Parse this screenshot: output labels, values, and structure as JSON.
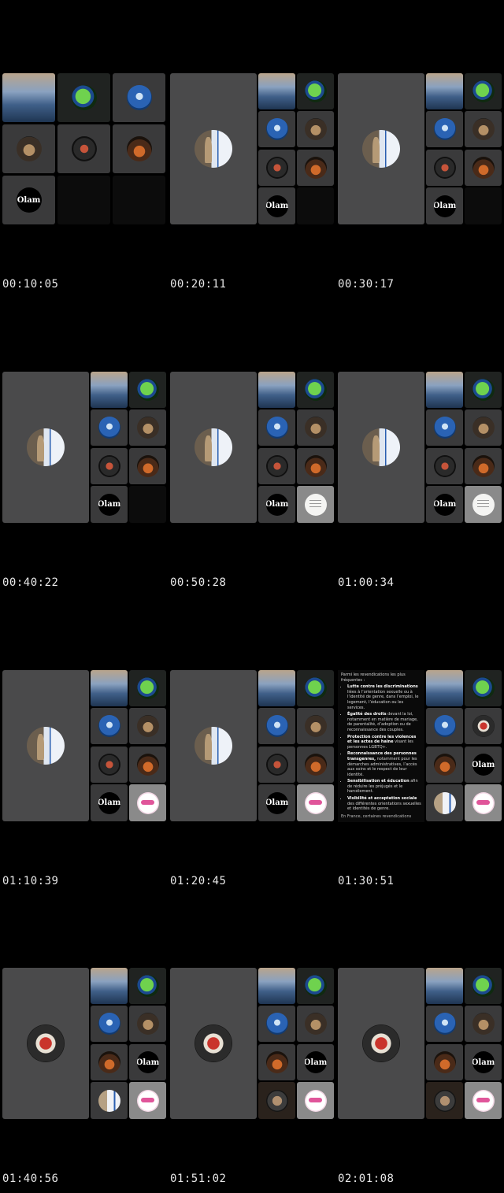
{
  "thumbnails": [
    {
      "timestamp": "00:10:05"
    },
    {
      "timestamp": "00:20:11"
    },
    {
      "timestamp": "00:30:17"
    },
    {
      "timestamp": "00:40:22"
    },
    {
      "timestamp": "00:50:28"
    },
    {
      "timestamp": "01:00:34"
    },
    {
      "timestamp": "01:10:39"
    },
    {
      "timestamp": "01:20:45"
    },
    {
      "timestamp": "01:30:51"
    },
    {
      "timestamp": "01:40:56"
    },
    {
      "timestamp": "01:51:02"
    },
    {
      "timestamp": "02:01:08"
    }
  ],
  "avatar_labels": {
    "olam": "Olam"
  },
  "document": {
    "intro": "Parmi les revendications les plus fréquentes :",
    "items": [
      {
        "bold": "Lutte contre les discriminations",
        "text": " liées à l’orientation sexuelle ou à l’identité de genre, dans l’emploi, le logement, l’éducation ou les services."
      },
      {
        "bold": "Égalité des droits",
        "text": " devant la loi, notamment en matière de mariage, de parentalité, d’adoption ou de reconnaissance des couples."
      },
      {
        "bold": "Protection contre les violences et les actes de haine",
        "text": " visant les personnes LGBTQ+."
      },
      {
        "bold": "Reconnaissance des personnes transgenres,",
        "text": " notamment pour les démarches administratives, l’accès aux soins et le respect de leur identité."
      },
      {
        "bold": "Sensibilisation et éducation",
        "text": " afin de réduire les préjugés et le harcèlement."
      },
      {
        "bold": "Visibilité et acceptation sociale",
        "text": " des différentes orientations sexuelles et identités de genre."
      }
    ],
    "footer": "En France, certaines revendications"
  },
  "colors": {
    "background": "#000000",
    "tile": "#3a3a3b",
    "timestamp_text": "#e8e8e8"
  }
}
